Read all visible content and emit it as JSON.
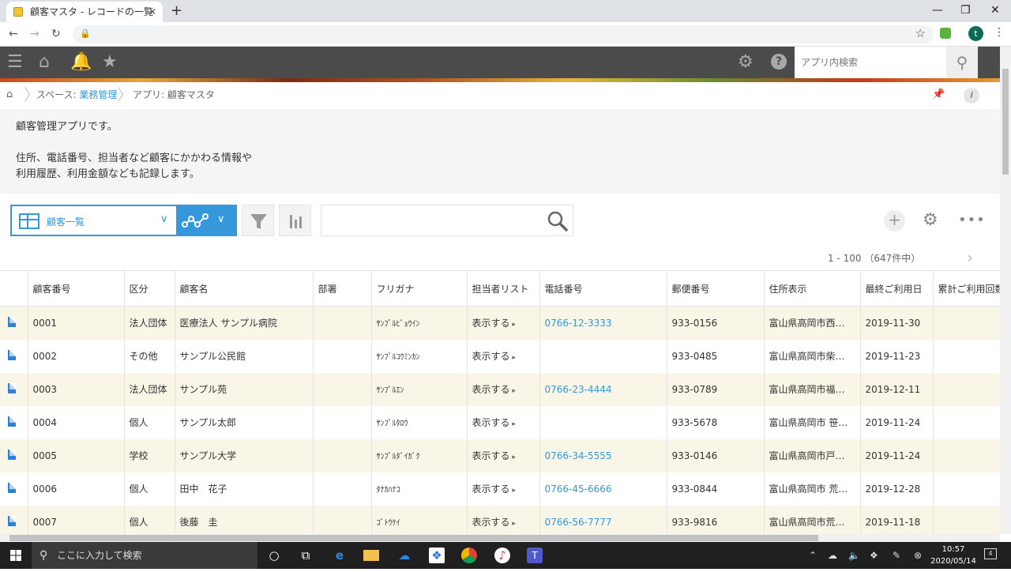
{
  "browser": {
    "tab_title": "顧客マスタ - レコードの一覧",
    "tab_close": "✕",
    "new_tab": "+",
    "avatar_initial": "t"
  },
  "header": {
    "search_placeholder": "アプリ内検索"
  },
  "breadcrumb": {
    "space_prefix": "スペース: ",
    "space_name": "業務管理",
    "app_label": "アプリ: 顧客マスタ"
  },
  "description": {
    "line1": "顧客管理アプリです。",
    "line2": "住所、電話番号、担当者など顧客にかかわる情報や",
    "line3": "利用履歴、利用金額なども記録します。"
  },
  "toolbar": {
    "view_name": "顧客一覧",
    "pager_text": "1 - 100 （647件中）"
  },
  "table": {
    "columns": [
      "顧客番号",
      "区分",
      "顧客名",
      "部署",
      "フリガナ",
      "担当者リスト",
      "電話番号",
      "郵便番号",
      "住所表示",
      "最終ご利用日",
      "累計ご利用回数"
    ],
    "rows": [
      {
        "id": "0001",
        "kubun": "法人団体",
        "name": "医療法人 サンプル病院",
        "busho": "",
        "kana": "ｻﾝﾌﾟﾙﾋﾞｮｳｲﾝ",
        "tanto": "表示する",
        "tel": "0766-12-3333",
        "zip": "933-0156",
        "addr": "富山県高岡市西…",
        "last": "2019-11-30"
      },
      {
        "id": "0002",
        "kubun": "その他",
        "name": "サンプル公民館",
        "busho": "",
        "kana": "ｻﾝﾌﾟﾙｺｳﾐﾝｶﾝ",
        "tanto": "表示する",
        "tel": "",
        "zip": "933-0485",
        "addr": "富山県高岡市柴…",
        "last": "2019-11-23"
      },
      {
        "id": "0003",
        "kubun": "法人団体",
        "name": "サンプル苑",
        "busho": "",
        "kana": "ｻﾝﾌﾟﾙｴﾝ",
        "tanto": "表示する",
        "tel": "0766-23-4444",
        "zip": "933-0789",
        "addr": "富山県高岡市福…",
        "last": "2019-12-11"
      },
      {
        "id": "0004",
        "kubun": "個人",
        "name": "サンプル太郎",
        "busho": "",
        "kana": "ｻﾝﾌﾟﾙﾀﾛｳ",
        "tanto": "表示する",
        "tel": "",
        "zip": "933-5678",
        "addr": "富山県高岡市 笹…",
        "last": "2019-11-24"
      },
      {
        "id": "0005",
        "kubun": "学校",
        "name": "サンプル大学",
        "busho": "",
        "kana": "ｻﾝﾌﾟﾙﾀﾞｲｶﾞｸ",
        "tanto": "表示する",
        "tel": "0766-34-5555",
        "zip": "933-0146",
        "addr": "富山県高岡市戸…",
        "last": "2019-11-24"
      },
      {
        "id": "0006",
        "kubun": "個人",
        "name": "田中　花子",
        "busho": "",
        "kana": "ﾀﾅｶﾊﾅｺ",
        "tanto": "表示する",
        "tel": "0766-45-6666",
        "zip": "933-0844",
        "addr": "富山県高岡市 荒…",
        "last": "2019-12-28"
      },
      {
        "id": "0007",
        "kubun": "個人",
        "name": "後藤　圭",
        "busho": "",
        "kana": "ｺﾞﾄｳｹｲ",
        "tanto": "表示する",
        "tel": "0766-56-7777",
        "zip": "933-9816",
        "addr": "富山県高岡市荒…",
        "last": "2019-11-18"
      }
    ]
  },
  "taskbar": {
    "search_placeholder": "ここに入力して検索",
    "time": "10:57",
    "date": "2020/05/14",
    "notification_count": "4"
  },
  "colors": {
    "accent": "#3498db",
    "header_bg": "#4b4b4b",
    "odd_row": "#f9f6e8"
  }
}
